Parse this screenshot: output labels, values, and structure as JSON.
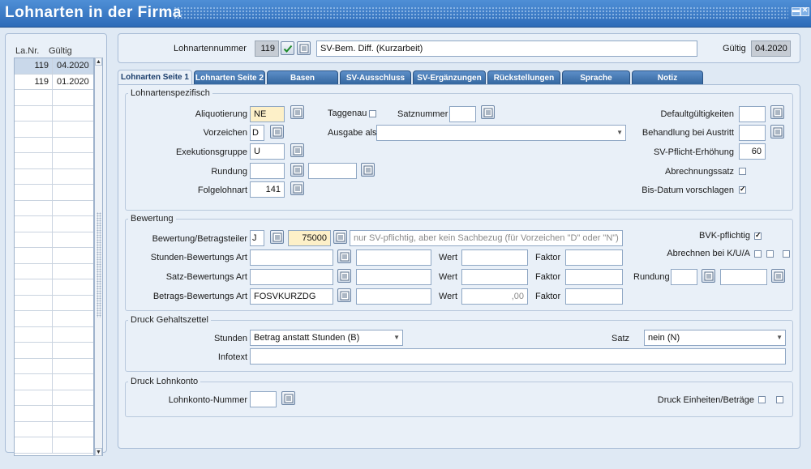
{
  "window": {
    "title": "Lohnarten in der Firma"
  },
  "list": {
    "col_nr": "La.Nr.",
    "col_gueltig": "Gültig",
    "rows": [
      {
        "nr": "119",
        "gueltig": "04.2020"
      },
      {
        "nr": "119",
        "gueltig": "01.2020"
      }
    ]
  },
  "header": {
    "lohnartennummer_label": "Lohnartennummer",
    "lohnartennummer_value": "119",
    "bezeichnung_value": "SV-Bem. Diff. (Kurzarbeit)",
    "gueltig_label": "Gültig",
    "gueltig_value": "04.2020"
  },
  "tabs": [
    {
      "label": "Lohnarten Seite 1"
    },
    {
      "label": "Lohnarten Seite 2"
    },
    {
      "label": "Basen"
    },
    {
      "label": "SV-Ausschluss"
    },
    {
      "label": "SV-Ergänzungen"
    },
    {
      "label": "Rückstellungen"
    },
    {
      "label": "Sprache"
    },
    {
      "label": "Notiz"
    }
  ],
  "lohnartenspezifisch": {
    "title": "Lohnartenspezifisch",
    "aliquotierung_label": "Aliquotierung",
    "aliquotierung_value": "NE",
    "vorzeichen_label": "Vorzeichen",
    "vorzeichen_value": "D",
    "exekutionsgruppe_label": "Exekutionsgruppe",
    "exekutionsgruppe_value": "U",
    "rundung_label": "Rundung",
    "folgelohnart_label": "Folgelohnart",
    "folgelohnart_value": "141",
    "taggenau_label": "Taggenau",
    "satznummer_label": "Satznummer",
    "ausgabe_als_label": "Ausgabe als",
    "defaultgueltigkeiten_label": "Defaultgültigkeiten",
    "behandlung_austritt_label": "Behandlung bei Austritt",
    "sv_pflicht_erhoehung_label": "SV-Pflicht-Erhöhung",
    "sv_pflicht_erhoehung_value": "60",
    "abrechnungssatz_label": "Abrechnungssatz",
    "bis_datum_label": "Bis-Datum vorschlagen",
    "bis_datum_checked": true
  },
  "bewertung": {
    "title": "Bewertung",
    "betragsteiler_label": "Bewertung/Betragsteiler",
    "betragsteiler_code": "J",
    "betragsteiler_value": "75000",
    "betragsteiler_desc": "nur SV-pflichtig, aber kein Sachbezug (für Vorzeichen \"D\" oder \"N\")",
    "stunden_label": "Stunden-Bewertungs Art",
    "satz_label": "Satz-Bewertungs Art",
    "betrags_label": "Betrags-Bewertungs Art",
    "betrags_value": "FOSVKURZDG",
    "wert_label": "Wert",
    "faktor_label": "Faktor",
    "betrags_wert_value": ",00",
    "bvk_label": "BVK-pflichtig",
    "bvk_checked": true,
    "abrechnen_label": "Abrechnen bei K/U/A",
    "rundung_label": "Rundung"
  },
  "druck_gehaltszettel": {
    "title": "Druck Gehaltszettel",
    "stunden_label": "Stunden",
    "stunden_value": "Betrag anstatt Stunden (B)",
    "satz_label": "Satz",
    "satz_value": "nein (N)",
    "infotext_label": "Infotext"
  },
  "druck_lohnkonto": {
    "title": "Druck Lohnkonto",
    "lohnkonto_nummer_label": "Lohnkonto-Nummer",
    "druck_einheiten_label": "Druck Einheiten/Beträge"
  },
  "colors": {
    "titlebar": "#2e6bb8",
    "tab": "#34679f",
    "yellow_field": "#fdf0c8",
    "panel": "#e9f0f8"
  }
}
